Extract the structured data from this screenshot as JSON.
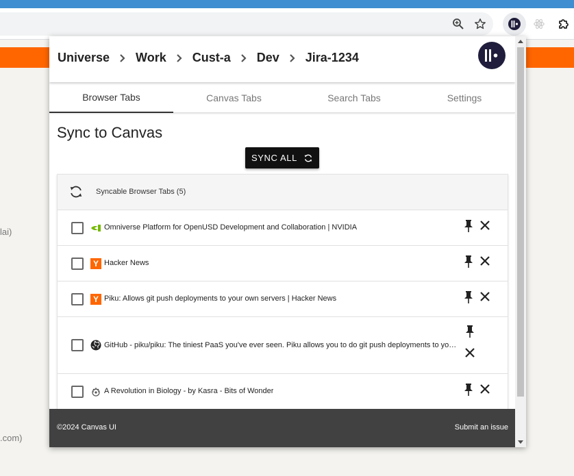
{
  "browser": {
    "toolbar_icons": [
      "zoom-icon",
      "bookmark-star-icon",
      "canvas-extension-icon",
      "react-devtools-icon",
      "extensions-puzzle-icon"
    ],
    "accent": "#3f8ed1"
  },
  "background_page": {
    "bar_color": "#ff6600",
    "snippet_1": "lai)",
    "snippet_2": ".com)"
  },
  "popup": {
    "breadcrumb": [
      "Universe",
      "Work",
      "Cust-a",
      "Dev",
      "Jira-1234"
    ],
    "tabs": [
      {
        "label": "Browser Tabs",
        "active": true
      },
      {
        "label": "Canvas Tabs",
        "active": false
      },
      {
        "label": "Search Tabs",
        "active": false
      },
      {
        "label": "Settings",
        "active": false
      }
    ],
    "heading": "Sync to Canvas",
    "sync_button": "SYNC ALL",
    "list_header": "Syncable Browser Tabs (5)",
    "items": [
      {
        "title": "Omniverse Platform for OpenUSD Development and Collaboration | NVIDIA",
        "favicon": "nvidia-icon"
      },
      {
        "title": "Hacker News",
        "favicon": "hacker-news-icon"
      },
      {
        "title": "Piku: Allows git push deployments to your own servers | Hacker News",
        "favicon": "hacker-news-icon"
      },
      {
        "title": "GitHub - piku/piku: The tiniest PaaS you've ever seen. Piku allows you to do git push deployments to your own servers.",
        "favicon": "github-icon"
      },
      {
        "title": "A Revolution in Biology - by Kasra - Bits of Wonder",
        "favicon": "bits-of-wonder-icon"
      }
    ],
    "footer": {
      "copyright": "©2024 Canvas UI",
      "issue_link": "Submit an issue"
    },
    "yc_letter": "Y",
    "colors": {
      "footer": "#414141",
      "logo": "#1f1d3b",
      "nvidia": "#76b900"
    }
  }
}
